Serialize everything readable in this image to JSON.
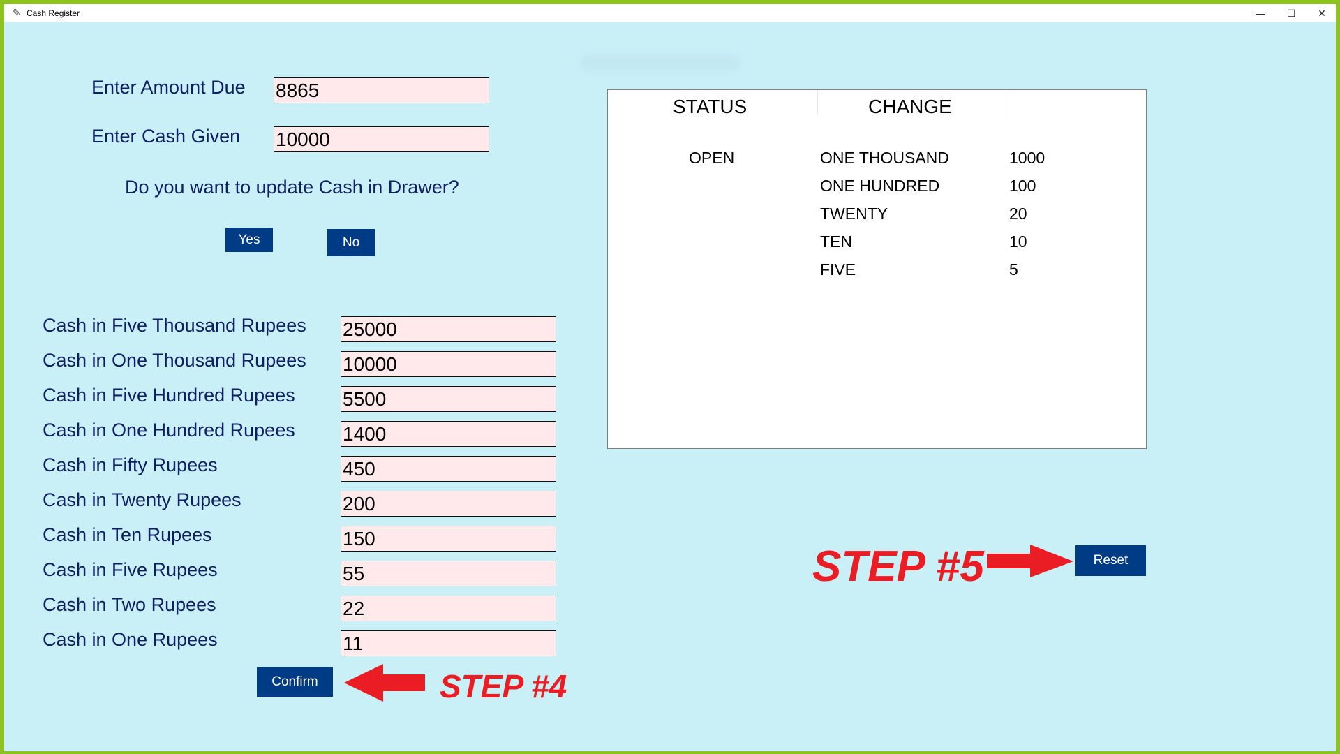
{
  "window": {
    "title": "Cash Register"
  },
  "titlebar": {
    "minimize": "—",
    "maximize": "☐",
    "close": "✕"
  },
  "form": {
    "amount_due_label": "Enter Amount Due",
    "amount_due_value": "8865",
    "cash_given_label": "Enter Cash Given",
    "cash_given_value": "10000",
    "update_question": "Do you want to update Cash in Drawer?",
    "yes_label": "Yes",
    "no_label": "No"
  },
  "drawer": [
    {
      "label": "Cash in Five Thousand Rupees",
      "value": "25000"
    },
    {
      "label": "Cash in One Thousand Rupees",
      "value": "10000"
    },
    {
      "label": "Cash in Five Hundred Rupees",
      "value": "5500"
    },
    {
      "label": "Cash in One Hundred Rupees",
      "value": "1400"
    },
    {
      "label": "Cash in Fifty Rupees",
      "value": "450"
    },
    {
      "label": "Cash in Twenty Rupees",
      "value": "200"
    },
    {
      "label": "Cash in Ten Rupees",
      "value": "150"
    },
    {
      "label": "Cash in Five Rupees",
      "value": "55"
    },
    {
      "label": "Cash in Two Rupees",
      "value": "22"
    },
    {
      "label": "Cash in One Rupees",
      "value": "11"
    }
  ],
  "confirm_label": "Confirm",
  "reset_label": "Reset",
  "result": {
    "status_header": "STATUS",
    "change_header": "CHANGE",
    "status_value": "OPEN",
    "rows": [
      {
        "denomination": "ONE THOUSAND",
        "amount": "1000"
      },
      {
        "denomination": "ONE HUNDRED",
        "amount": "100"
      },
      {
        "denomination": "TWENTY",
        "amount": "20"
      },
      {
        "denomination": "TEN",
        "amount": "10"
      },
      {
        "denomination": "FIVE",
        "amount": "5"
      }
    ]
  },
  "annotations": {
    "step4": "STEP #4",
    "step5": "STEP #5",
    "color": "#ea1c24"
  }
}
